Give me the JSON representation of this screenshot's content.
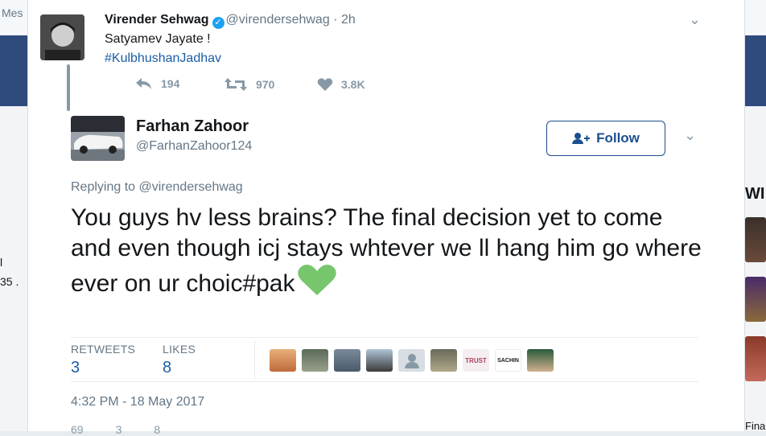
{
  "background": {
    "left_partial_top": "Mes",
    "left_partial_mid": "l",
    "left_partial_mid2": "35 .",
    "right_partial_heading": "WI",
    "right_partial_bottom": "Fina"
  },
  "original_tweet": {
    "author_name": "Virender Sehwag",
    "verified_glyph": "✓",
    "handle": "@virendersehwag",
    "age": "· 2h",
    "text": "Satyamev Jayate !",
    "hashtag": "#KulbhushanJadhav",
    "replies": "194",
    "retweets": "970",
    "likes": "3.8K"
  },
  "reply_tweet": {
    "author_name": "Farhan Zahoor",
    "handle": "@FarhanZahoor124",
    "follow_label": "Follow",
    "replying_to": "Replying to @virendersehwag",
    "text": "You guys hv less brains?  The final decision yet to come and even though icj stays whtever we ll hang him go where ever on ur choic#pak",
    "retweets_label": "RETWEETS",
    "retweets_count": "3",
    "likes_label": "LIKES",
    "likes_count": "8",
    "timestamp": "4:32 PM - 18 May 2017",
    "liker_badges": [
      "TRUST",
      "SACHIN"
    ]
  },
  "bottom_actions": [
    "69",
    "3",
    "8"
  ],
  "colors": {
    "brand_blue": "#1b5ea6",
    "verified_blue": "#1da1f2",
    "heart_green": "#77c66e",
    "header_band": "#2f4a7d"
  }
}
